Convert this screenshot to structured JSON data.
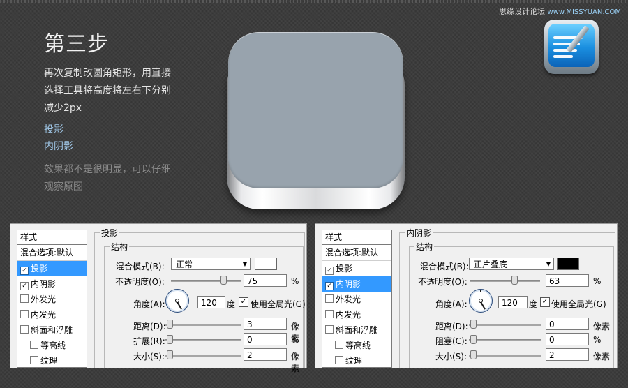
{
  "watermark": {
    "brand": "思缘设计论坛",
    "site": "www.MISSYUAN.COM"
  },
  "step": {
    "title": "第三步",
    "lines": [
      "再次复制改圆角矩形，用直接",
      "选择工具将高度将左右下分别",
      "减少2px"
    ],
    "links": [
      "投影",
      "内阴影"
    ],
    "note": [
      "效果都不是很明显，可以仔细",
      "观察原图"
    ]
  },
  "colors": {
    "preview_face": "#98a3ad",
    "selected": "#3399ff",
    "link": "#9fc6e6"
  },
  "panels": [
    {
      "styles": {
        "header": "样式",
        "items": [
          {
            "label": "混合选项:默认",
            "checked": null,
            "sub": false,
            "selected": false
          },
          {
            "label": "投影",
            "checked": true,
            "sub": false,
            "selected": true
          },
          {
            "label": "内阴影",
            "checked": true,
            "sub": false,
            "selected": false
          },
          {
            "label": "外发光",
            "checked": false,
            "sub": false,
            "selected": false
          },
          {
            "label": "内发光",
            "checked": false,
            "sub": false,
            "selected": false
          },
          {
            "label": "斜面和浮雕",
            "checked": false,
            "sub": false,
            "selected": false
          },
          {
            "label": "等高线",
            "checked": false,
            "sub": true,
            "selected": false
          },
          {
            "label": "纹理",
            "checked": false,
            "sub": true,
            "selected": false
          }
        ]
      },
      "group_title": "投影",
      "section_title": "结构",
      "blend_label": "混合模式(B):",
      "blend_value": "正常",
      "swatch_color": "#ffffff",
      "opacity_label": "不透明度(O):",
      "opacity_value": "75",
      "opacity_unit": "%",
      "opacity_fraction": 0.75,
      "angle_label": "角度(A):",
      "angle_value": "120",
      "angle_unit": "度",
      "global_light_label": "使用全局光(G)",
      "global_light": true,
      "row1_label": "距离(D):",
      "row1_value": "3",
      "row1_unit": "像素",
      "row2_label": "扩展(R):",
      "row2_value": "0",
      "row2_unit": "%",
      "row3_label": "大小(S):",
      "row3_value": "2",
      "row3_unit": "像素"
    },
    {
      "styles": {
        "header": "样式",
        "items": [
          {
            "label": "混合选项:默认",
            "checked": null,
            "sub": false,
            "selected": false
          },
          {
            "label": "投影",
            "checked": true,
            "sub": false,
            "selected": false
          },
          {
            "label": "内阴影",
            "checked": true,
            "sub": false,
            "selected": true
          },
          {
            "label": "外发光",
            "checked": false,
            "sub": false,
            "selected": false
          },
          {
            "label": "内发光",
            "checked": false,
            "sub": false,
            "selected": false
          },
          {
            "label": "斜面和浮雕",
            "checked": false,
            "sub": false,
            "selected": false
          },
          {
            "label": "等高线",
            "checked": false,
            "sub": true,
            "selected": false
          },
          {
            "label": "纹理",
            "checked": false,
            "sub": true,
            "selected": false
          }
        ]
      },
      "group_title": "内阴影",
      "section_title": "结构",
      "blend_label": "混合模式(B):",
      "blend_value": "正片叠底",
      "swatch_color": "#000000",
      "opacity_label": "不透明度(O):",
      "opacity_value": "63",
      "opacity_unit": "%",
      "opacity_fraction": 0.63,
      "angle_label": "角度(A):",
      "angle_value": "120",
      "angle_unit": "度",
      "global_light_label": "使用全局光(G)",
      "global_light": true,
      "row1_label": "距离(D):",
      "row1_value": "0",
      "row1_unit": "像素",
      "row2_label": "阻塞(C):",
      "row2_value": "0",
      "row2_unit": "%",
      "row3_label": "大小(S):",
      "row3_value": "2",
      "row3_unit": "像素"
    }
  ]
}
